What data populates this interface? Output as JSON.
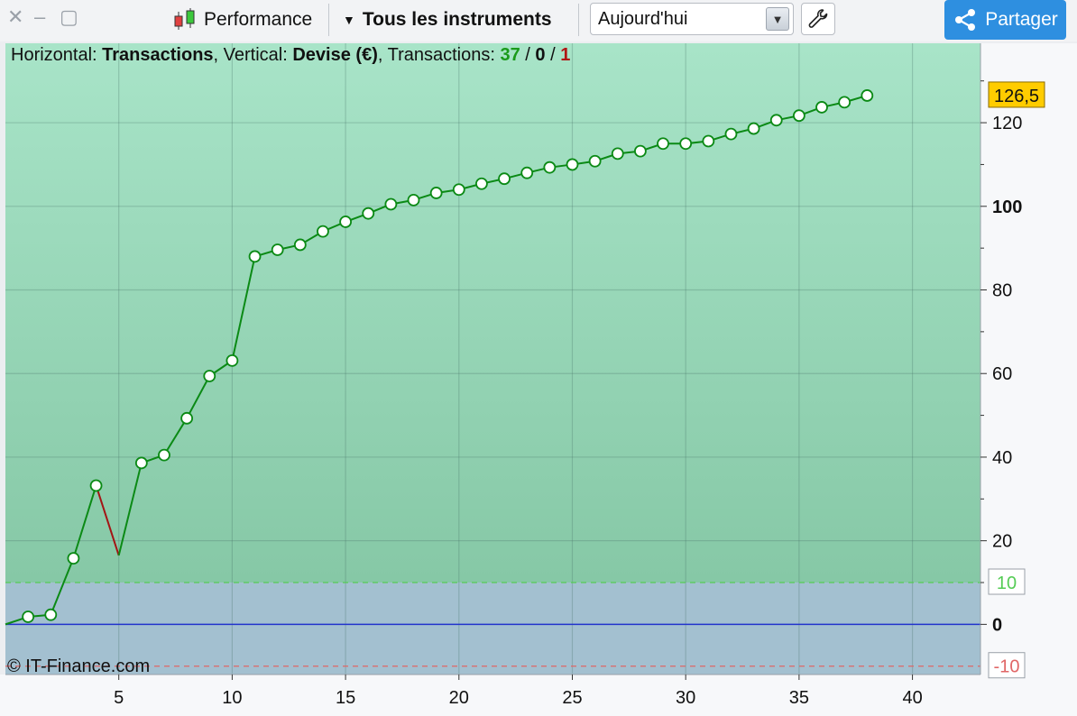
{
  "window": {
    "controls": [
      "✕",
      "–",
      "▢"
    ]
  },
  "toolbar": {
    "performance_label": "Performance",
    "instruments_label": "Tous les instruments",
    "period_value": "Aujourd'hui",
    "share_label": "Partager"
  },
  "info": {
    "horizontal_label": "Horizontal: ",
    "horizontal_value": "Transactions",
    "vertical_label": ", Vertical: ",
    "vertical_value": "Devise (€)",
    "transactions_label": ", Transactions: ",
    "trans_win": "37",
    "slash1": " / ",
    "trans_neutral": "0",
    "slash2": " / ",
    "trans_loss": "1"
  },
  "copyright": "© IT-Finance.com",
  "chart_data": {
    "type": "line",
    "xlabel": "Transactions",
    "ylabel": "Devise (€)",
    "xlim": [
      0,
      43
    ],
    "ylim": [
      -12,
      139
    ],
    "x_ticks": [
      5,
      10,
      15,
      20,
      25,
      30,
      35,
      40
    ],
    "y_ticks": [
      0,
      20,
      40,
      60,
      80,
      100,
      120
    ],
    "series": [
      {
        "x": [
          0,
          1,
          2,
          3,
          4,
          5,
          6,
          7,
          8,
          9,
          10,
          11,
          12,
          13,
          14,
          15,
          16,
          17,
          18,
          19,
          20,
          21,
          22,
          23,
          24,
          25,
          26,
          27,
          28,
          29,
          30,
          31,
          32,
          33,
          34,
          35,
          36,
          37,
          38
        ],
        "y": [
          0,
          1.8,
          2.3,
          15.8,
          33.2,
          16.5,
          38.6,
          40.5,
          49.3,
          59.4,
          63.1,
          88,
          89.6,
          90.8,
          94,
          96.3,
          98.3,
          100.5,
          101.5,
          103.2,
          104,
          105.4,
          106.6,
          108,
          109.3,
          110,
          110.8,
          112.6,
          113.2,
          115,
          115,
          115.6,
          117.3,
          118.6,
          120.6,
          121.7,
          123.7,
          124.9,
          126.5
        ]
      }
    ],
    "colors": {
      "win": "#0b8a15",
      "loss": "#a31515",
      "zero_line": "#2233cc",
      "upper_threshold": "#55cc55",
      "lower_threshold": "#e06666",
      "last_value_bg": "#ffcc00"
    },
    "reference_lines": [
      {
        "value": 10,
        "label": "10"
      },
      {
        "value": -10,
        "label": "-10"
      }
    ],
    "last_value_label": "126,5",
    "grid": true
  }
}
